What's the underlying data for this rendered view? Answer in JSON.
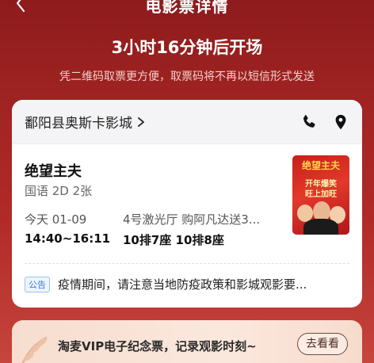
{
  "header": {
    "title": "电影票详情"
  },
  "status": {
    "countdown": "3小时16分钟后开场",
    "note": "凭二维码取票更方便，取票码将不再以短信形式发送"
  },
  "cinema": {
    "name": "鄱阳县奥斯卡影城"
  },
  "movie": {
    "title": "绝望主夫",
    "meta": "国语 2D 2张",
    "poster_title": "绝望主夫",
    "poster_slogan_1": "开年爆笑",
    "poster_slogan_2": "旺上加旺"
  },
  "schedule": {
    "date": "今天 01-09",
    "time": "14:40~16:11",
    "hall": "4号激光厅 购阿凡达送3...",
    "seats": "10排7座  10排8座"
  },
  "notice": {
    "badge": "公告",
    "text": "疫情期间，请注意当地防疫政策和影城观影要..."
  },
  "banner": {
    "text": "淘麦VIP电子纪念票，记录观影时刻~",
    "button": "去看看"
  }
}
